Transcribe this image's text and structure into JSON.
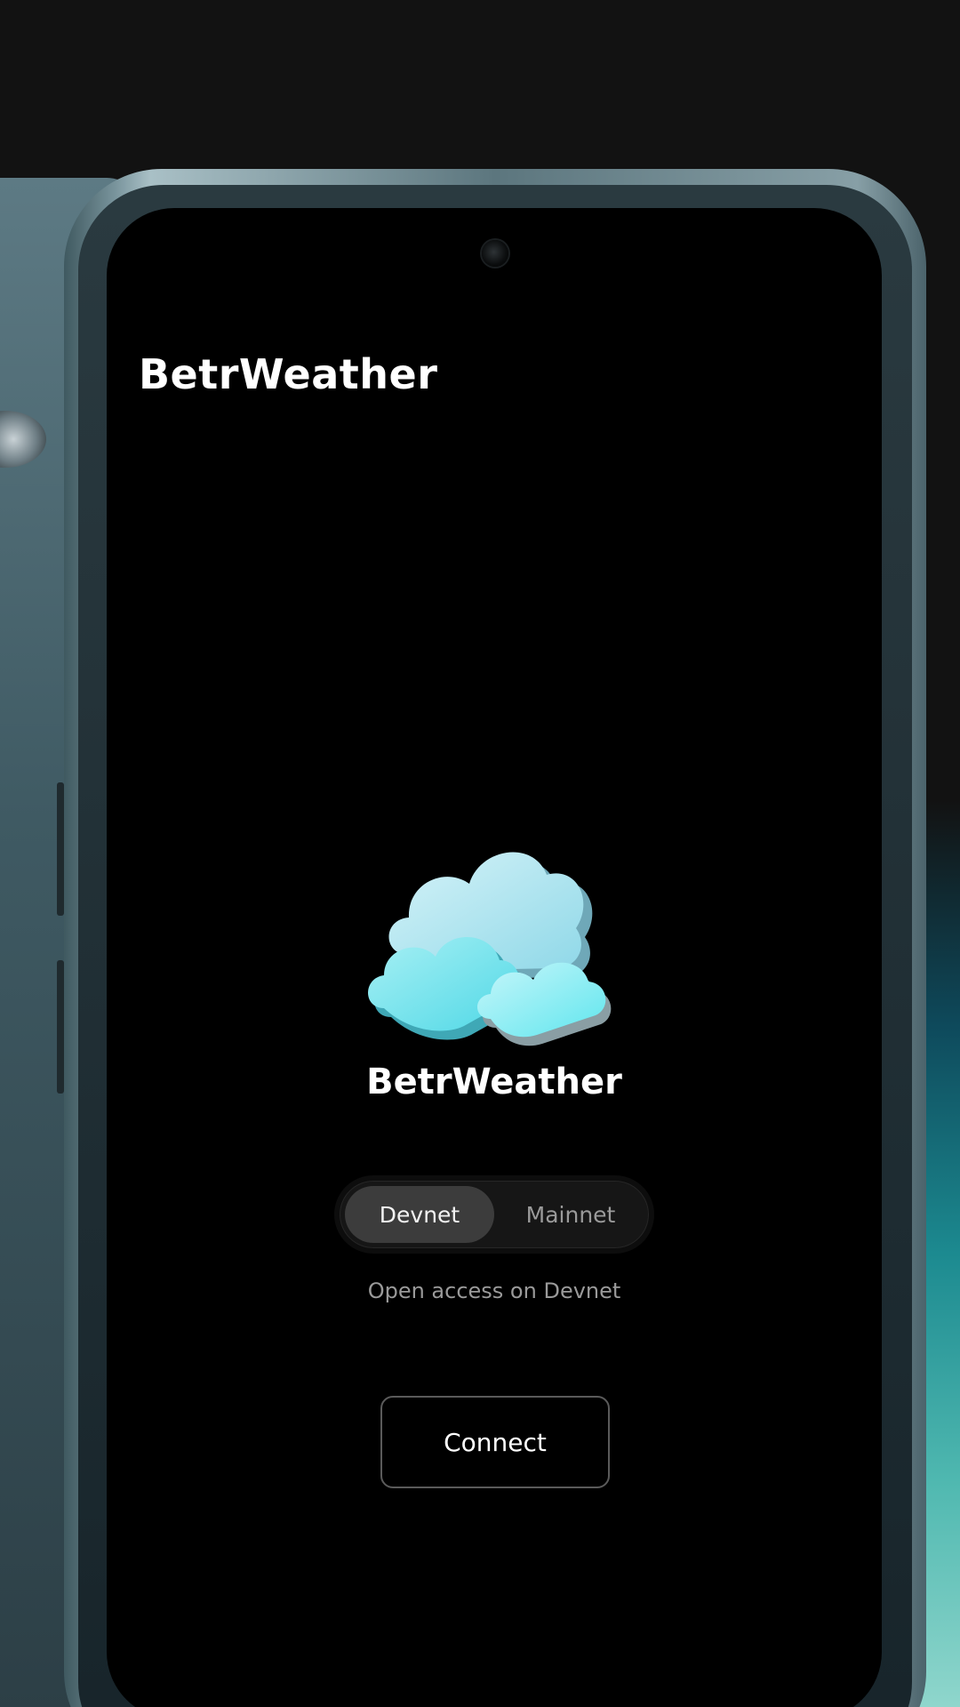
{
  "app": {
    "header_title": "BetrWeather",
    "name": "BetrWeather"
  },
  "network_toggle": {
    "options": [
      "Devnet",
      "Mainnet"
    ],
    "selected": "Devnet",
    "description": "Open access on Devnet"
  },
  "actions": {
    "connect_label": "Connect"
  },
  "icons": {
    "logo": "cloud-logo-icon",
    "front_camera": "front-camera-icon"
  },
  "colors": {
    "screen_background": "#000000",
    "accent_cloud_light": "#bfeaf2",
    "accent_cloud_cyan": "#5fe6ee",
    "toggle_active": "#3c3c3c",
    "muted_text": "#9a9a9a"
  }
}
